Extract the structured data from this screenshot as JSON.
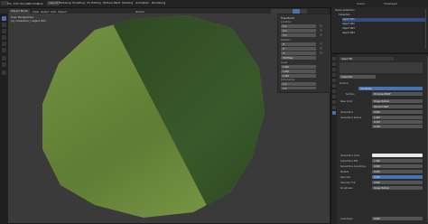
{
  "header": {
    "menus": [
      "File",
      "Edit",
      "Render",
      "Window",
      "Help"
    ],
    "workspaces": [
      "Layout",
      "Modeling",
      "Sculpting",
      "UV Editing",
      "Texture Paint",
      "Shading",
      "Animation",
      "Rendering"
    ],
    "scene": "Scene",
    "view_layer": "ViewLayer"
  },
  "viewport_header": {
    "mode": "Object Mode",
    "menus": [
      "View",
      "Select",
      "Add",
      "Object"
    ],
    "global": "Global"
  },
  "viewport": {
    "view_name": "User Perspective",
    "collection_info": "(1) Collection | object 001"
  },
  "npanel": {
    "section": "Transform",
    "location_label": "Location:",
    "location_values": [
      "0 m",
      "0 m",
      "0 m"
    ],
    "rotation_label": "Rotation:",
    "rotation_values": [
      "0°",
      "0°",
      "0°"
    ],
    "mode_value": "XYZ Euler",
    "scale_label": "Scale:",
    "scale_values": [
      "1.000",
      "1.000",
      "1.000"
    ],
    "dimensions_label": "Dimensions:",
    "dimensions_values": [
      "2 m",
      "2 m",
      "0 m"
    ]
  },
  "outliner": {
    "title": "Scene Collection",
    "items": [
      "Collection",
      "object 001",
      "object 002",
      "object 003",
      "object 004"
    ]
  },
  "properties": {
    "object_name": "object 001",
    "material_name": "Grass 001",
    "surface_section": "Surface",
    "use_nodes": "Use Nodes",
    "surface_shader": "Principled BSDF",
    "rows": [
      {
        "label": "Base Color",
        "value": "Image Texture"
      },
      {
        "label": "",
        "value": "Random Walk"
      },
      {
        "label": "Subsurface",
        "value": "0.000"
      },
      {
        "label": "Subsurface Radius",
        "value": "1.000"
      },
      {
        "label": "",
        "value": "0.200"
      },
      {
        "label": "",
        "value": "0.100"
      },
      {
        "label": "Subsurface Color",
        "value": ""
      },
      {
        "label": "Subsurface IOR",
        "value": "1.400"
      },
      {
        "label": "Subsurface Anisotropy",
        "value": "0.000"
      },
      {
        "label": "Metallic",
        "value": "0.000"
      },
      {
        "label": "Specular",
        "value": "0.500"
      },
      {
        "label": "Specular Tint",
        "value": "0.000"
      },
      {
        "label": "Roughness",
        "value": "Image Texture"
      },
      {
        "label": "Anisotropic",
        "value": "0.000"
      },
      {
        "label": "Anisotropic Rotation",
        "value": "0.000"
      },
      {
        "label": "Sheen",
        "value": "0.000"
      },
      {
        "label": "Sheen Tint",
        "value": "0.500"
      },
      {
        "label": "Clearcoat",
        "value": "0.000"
      }
    ]
  },
  "colors": {
    "accent": "#4772b3",
    "grass_light": "#6f8a3c",
    "grass_dark": "#2f4a22"
  }
}
